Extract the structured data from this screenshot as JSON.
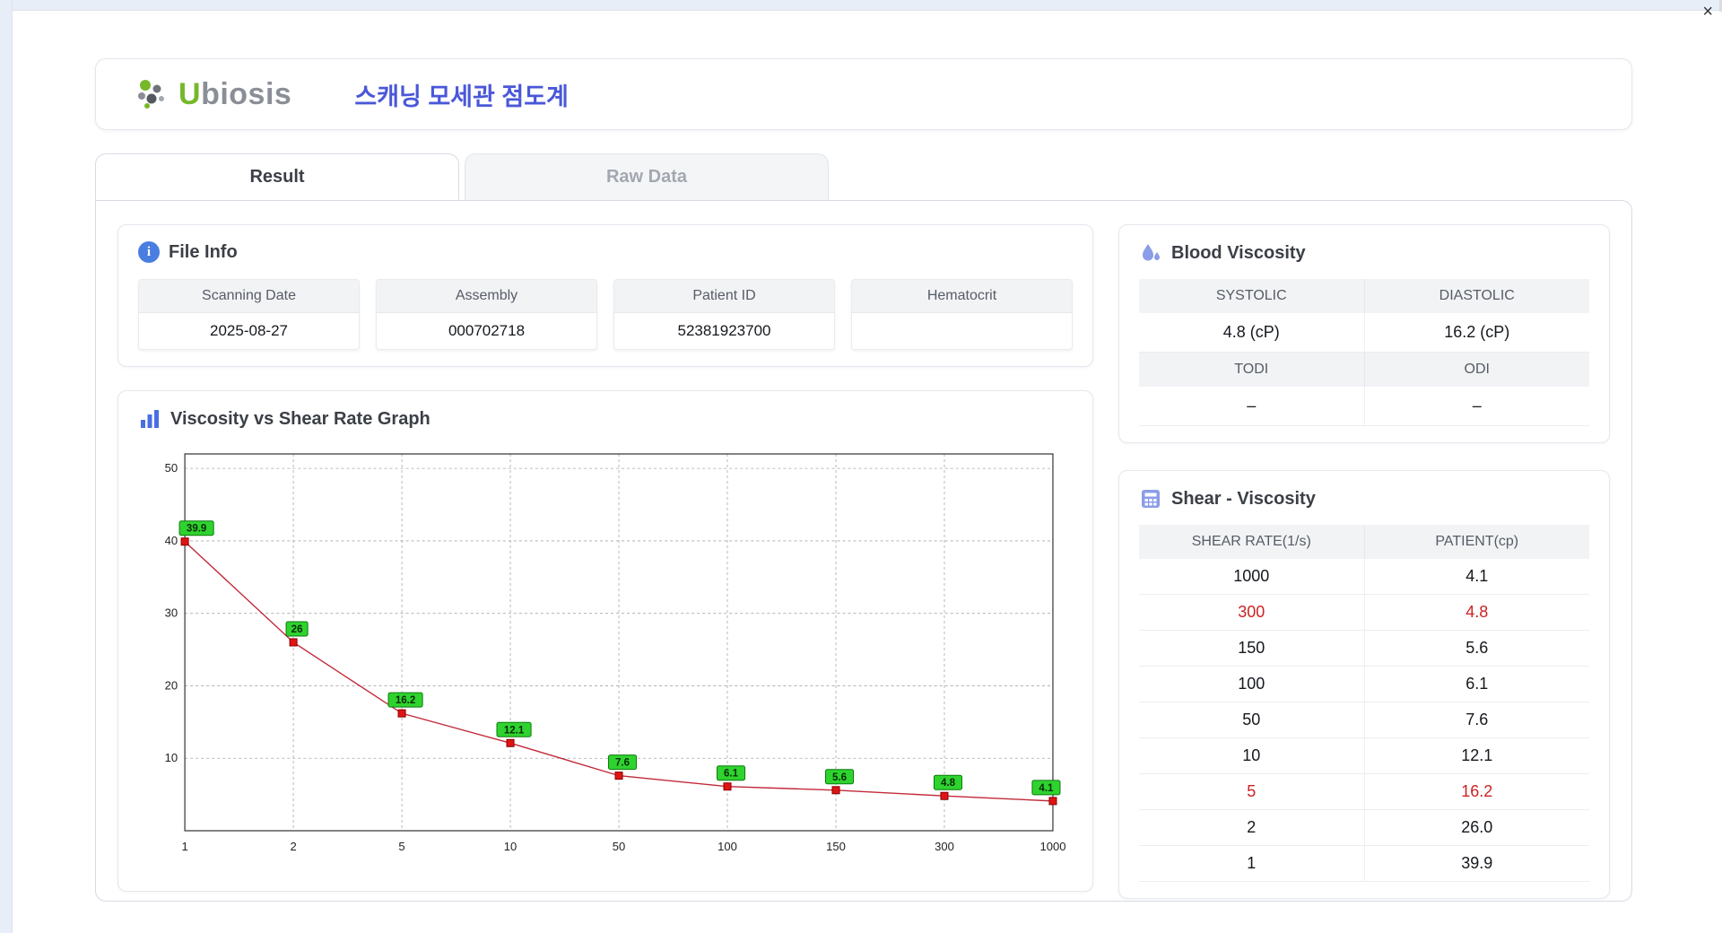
{
  "window": {
    "close": "×"
  },
  "header": {
    "brand_primary": "U",
    "brand_secondary": "biosis",
    "app_title": "스캐닝 모세관 점도계"
  },
  "tabs": [
    {
      "label": "Result",
      "active": true
    },
    {
      "label": "Raw Data",
      "active": false
    }
  ],
  "file_info": {
    "title": "File Info",
    "fields": [
      {
        "label": "Scanning Date",
        "value": "2025-08-27"
      },
      {
        "label": "Assembly",
        "value": "000702718"
      },
      {
        "label": "Patient ID",
        "value": "52381923700"
      },
      {
        "label": "Hematocrit",
        "value": ""
      }
    ]
  },
  "graph": {
    "title": "Viscosity vs Shear Rate Graph"
  },
  "chart_data": {
    "type": "line",
    "title": "Viscosity vs Shear Rate Graph",
    "xlabel": "",
    "ylabel": "",
    "x": [
      "1",
      "2",
      "5",
      "10",
      "50",
      "100",
      "150",
      "300",
      "1000"
    ],
    "values": [
      39.9,
      26,
      16.2,
      12.1,
      7.6,
      6.1,
      5.6,
      4.8,
      4.1
    ],
    "point_labels": [
      "39.9",
      "26",
      "16.2",
      "12.1",
      "7.6",
      "6.1",
      "5.6",
      "4.8",
      "4.1"
    ],
    "yticks": [
      10,
      20,
      30,
      40,
      50
    ],
    "ylim": [
      0,
      52
    ],
    "x_axis_type": "categorical-log-ticks",
    "grid": true,
    "line_color": "#c22a3a",
    "marker_color": "#e01414",
    "marker_edge_color": "#8a0000",
    "label_bg": "#2fd32f",
    "label_border": "#0c7a0c"
  },
  "blood_viscosity": {
    "title": "Blood Viscosity",
    "rows": [
      {
        "headers": [
          "SYSTOLIC",
          "DIASTOLIC"
        ],
        "values": [
          "4.8 (cP)",
          "16.2 (cP)"
        ]
      },
      {
        "headers": [
          "TODI",
          "ODI"
        ],
        "values": [
          "–",
          "–"
        ]
      }
    ]
  },
  "shear_viscosity": {
    "title": "Shear - Viscosity",
    "columns": [
      "SHEAR RATE(1/s)",
      "PATIENT(cp)"
    ],
    "rows": [
      {
        "shear": "1000",
        "patient": "4.1",
        "highlight": false
      },
      {
        "shear": "300",
        "patient": "4.8",
        "highlight": true
      },
      {
        "shear": "150",
        "patient": "5.6",
        "highlight": false
      },
      {
        "shear": "100",
        "patient": "6.1",
        "highlight": false
      },
      {
        "shear": "50",
        "patient": "7.6",
        "highlight": false
      },
      {
        "shear": "10",
        "patient": "12.1",
        "highlight": false
      },
      {
        "shear": "5",
        "patient": "16.2",
        "highlight": true
      },
      {
        "shear": "2",
        "patient": "26.0",
        "highlight": false
      },
      {
        "shear": "1",
        "patient": "39.9",
        "highlight": false
      }
    ]
  },
  "colors": {
    "accent_blue": "#4a57d8",
    "brand_green": "#76b82a",
    "highlight_red": "#cc2222",
    "icon_periwinkle": "#8b9ce8",
    "icon_blue": "#4a7de0"
  }
}
